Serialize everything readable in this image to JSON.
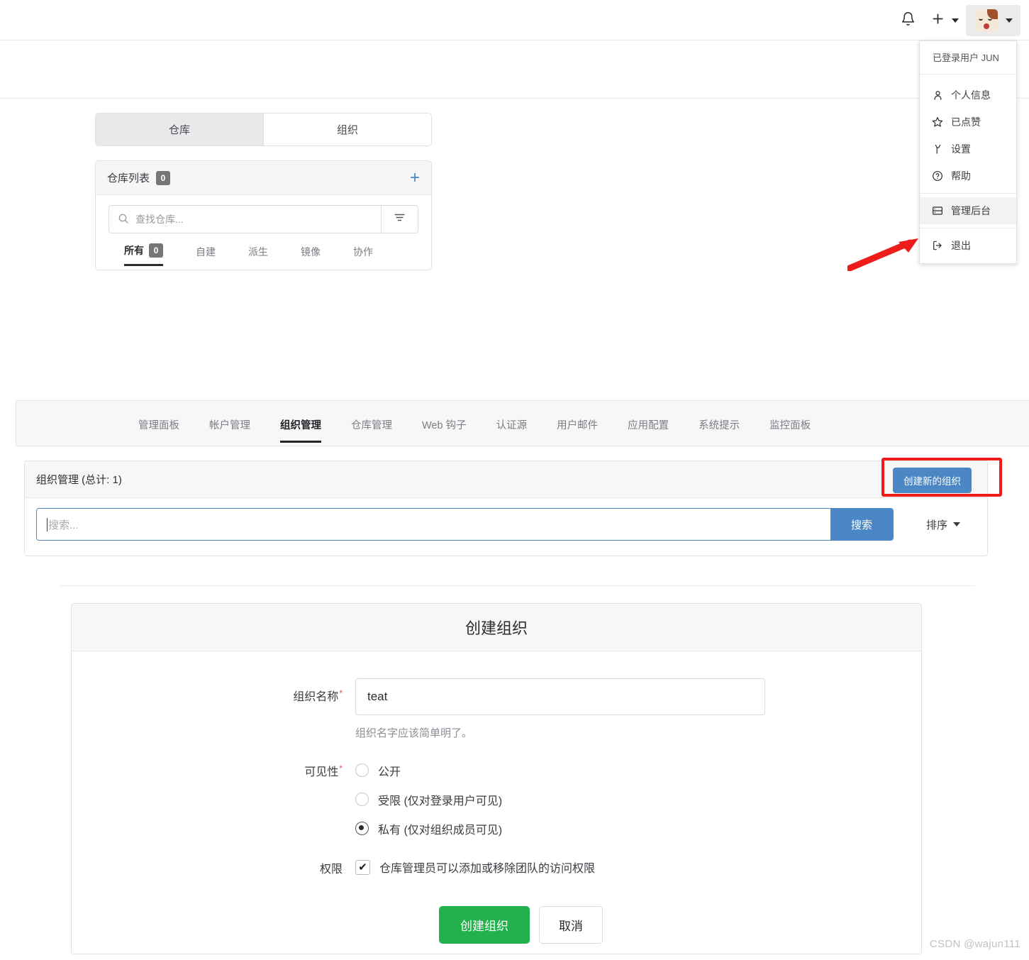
{
  "navbar": {
    "bell_icon": "bell-icon",
    "plus_icon": "plus-icon",
    "avatar_alt": "user-avatar"
  },
  "user_menu": {
    "header": "已登录用户 JUN",
    "items": [
      {
        "label": "个人信息",
        "icon": "person-icon",
        "active": false
      },
      {
        "label": "已点赞",
        "icon": "star-icon",
        "active": false
      },
      {
        "label": "设置",
        "icon": "wrench-icon",
        "active": false
      },
      {
        "label": "帮助",
        "icon": "question-circle-icon",
        "active": false
      },
      {
        "label": "管理后台",
        "icon": "server-icon",
        "active": true
      },
      {
        "label": "退出",
        "icon": "sign-out-icon",
        "active": false
      }
    ]
  },
  "dashboard": {
    "segment_tabs": [
      {
        "label": "仓库",
        "active": true
      },
      {
        "label": "组织",
        "active": false
      }
    ],
    "repo_card": {
      "title": "仓库列表",
      "count": "0",
      "add_icon": "plus-icon",
      "search_placeholder": "查找仓库...",
      "search_icon": "search-icon",
      "filter_icon": "filter-icon",
      "filter_tabs": [
        {
          "label": "所有",
          "count": "0",
          "active": true
        },
        {
          "label": "自建",
          "count": "",
          "active": false
        },
        {
          "label": "派生",
          "count": "",
          "active": false
        },
        {
          "label": "镜像",
          "count": "",
          "active": false
        },
        {
          "label": "协作",
          "count": "",
          "active": false
        }
      ]
    }
  },
  "admin": {
    "tabs": [
      {
        "label": "管理面板",
        "active": false
      },
      {
        "label": "帐户管理",
        "active": false
      },
      {
        "label": "组织管理",
        "active": true
      },
      {
        "label": "仓库管理",
        "active": false
      },
      {
        "label": "Web 钩子",
        "active": false
      },
      {
        "label": "认证源",
        "active": false
      },
      {
        "label": "用户邮件",
        "active": false
      },
      {
        "label": "应用配置",
        "active": false
      },
      {
        "label": "系统提示",
        "active": false
      },
      {
        "label": "监控面板",
        "active": false
      }
    ],
    "panel": {
      "title": "组织管理 (总计: 1)",
      "create_button": "创建新的组织",
      "search_placeholder": "搜索...",
      "search_value": "",
      "search_button": "搜索",
      "sort_label": "排序"
    }
  },
  "create_org_form": {
    "title": "创建组织",
    "name_label": "组织名称",
    "name_required": "*",
    "name_value": "teat",
    "name_help": "组织名字应该简单明了。",
    "visibility_label": "可见性",
    "visibility_required": "*",
    "visibility_options": [
      {
        "label": "公开",
        "checked": false
      },
      {
        "label": "受限 (仅对登录用户可见)",
        "checked": false
      },
      {
        "label": "私有 (仅对组织成员可见)",
        "checked": true
      }
    ],
    "permission_label": "权限",
    "permission_option": {
      "label": "仓库管理员可以添加或移除团队的访问权限",
      "checked": true
    },
    "submit_button": "创建组织",
    "cancel_button": "取消"
  },
  "watermark": "CSDN @wajun111",
  "colors": {
    "primary_blue": "#4a87c4",
    "success_green": "#22b14c",
    "annotation_red": "#ef1c1c",
    "badge_gray": "#767676"
  }
}
